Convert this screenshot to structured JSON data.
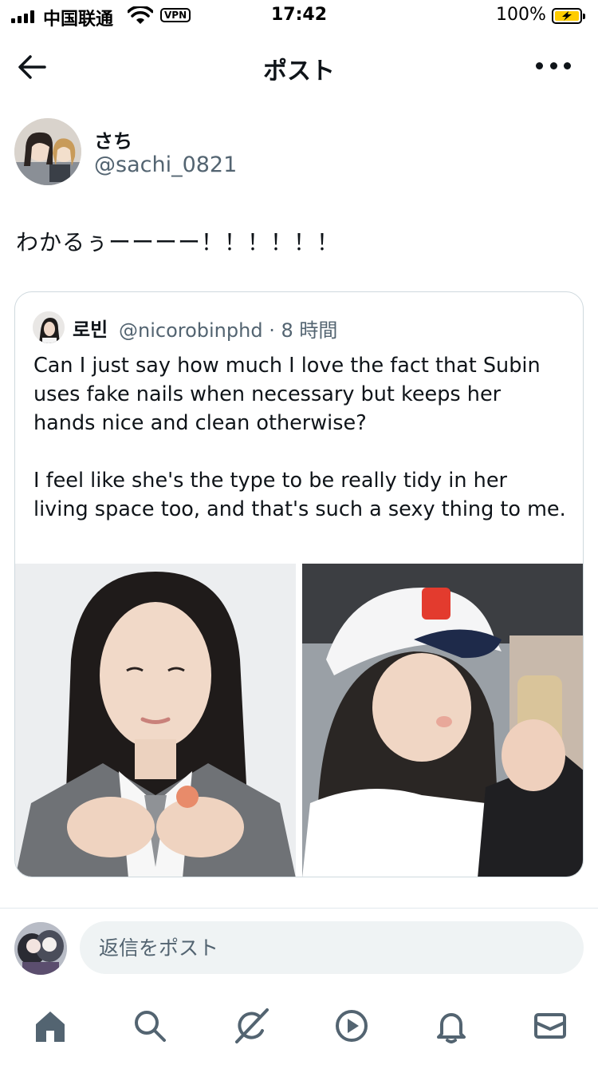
{
  "status_bar": {
    "carrier": "中国联通",
    "vpn": "VPN",
    "time": "17:42",
    "battery_percent": "100%",
    "battery_color": "#ffcc00",
    "battery_level": 1.0
  },
  "header": {
    "title": "ポスト",
    "back_icon": "arrow-left-icon",
    "more_icon": "more-horizontal-icon"
  },
  "post": {
    "author_name": "さち",
    "author_handle": "@sachi_0821",
    "text": "わかるぅーーーー！！！！！！"
  },
  "quote": {
    "author_name": "로빈",
    "meta": "@nicorobinphd · 8 時間",
    "paragraphs": [
      "Can I just say how much I love the fact that Subin uses fake nails when necessary but keeps her hands nice and clean otherwise?",
      "I feel like she's the type to be really tidy in her living space too, and that's such a sexy thing to me."
    ]
  },
  "reply": {
    "placeholder": "返信をポスト"
  },
  "tab_bar": [
    {
      "icon": "home-icon"
    },
    {
      "icon": "search-icon"
    },
    {
      "icon": "grok-icon"
    },
    {
      "icon": "video-play-icon"
    },
    {
      "icon": "bell-icon"
    },
    {
      "icon": "mail-icon"
    }
  ],
  "colors": {
    "primary_text": "#0f1419",
    "secondary_text": "#536471",
    "border": "#cfd9de",
    "input_bg": "#eff3f4"
  }
}
